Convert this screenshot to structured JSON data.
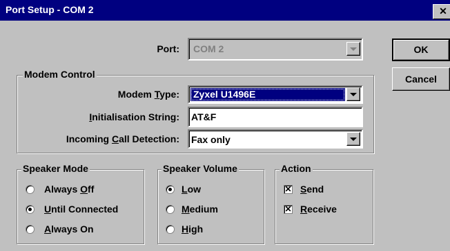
{
  "window": {
    "title": "Port Setup - COM 2",
    "close_glyph": "✕"
  },
  "port": {
    "label": "Port:",
    "value": "COM 2"
  },
  "buttons": {
    "ok": "OK",
    "cancel": "Cancel"
  },
  "modem_control": {
    "title": "Modem Control",
    "type_label_pre": "Modem ",
    "type_label_key": "T",
    "type_label_post": "ype:",
    "type_value": "Zyxel U1496E",
    "init_label_key": "I",
    "init_label_post": "nitialisation String:",
    "init_value": "AT&F",
    "call_label_pre": "Incoming ",
    "call_label_key": "C",
    "call_label_post": "all Detection:",
    "call_value": "Fax only"
  },
  "speaker_mode": {
    "title": "Speaker Mode",
    "options": [
      {
        "pre": "Always ",
        "key": "O",
        "post": "ff",
        "selected": false
      },
      {
        "pre": "",
        "key": "U",
        "post": "ntil Connected",
        "selected": true
      },
      {
        "pre": "",
        "key": "A",
        "post": "lways On",
        "selected": false
      }
    ]
  },
  "speaker_volume": {
    "title": "Speaker Volume",
    "options": [
      {
        "pre": "",
        "key": "L",
        "post": "ow",
        "selected": true
      },
      {
        "pre": "",
        "key": "M",
        "post": "edium",
        "selected": false
      },
      {
        "pre": "",
        "key": "H",
        "post": "igh",
        "selected": false
      }
    ]
  },
  "action": {
    "title": "Action",
    "check_glyph": "✕",
    "options": [
      {
        "key": "S",
        "post": "end",
        "checked": true
      },
      {
        "key": "R",
        "post": "eceive",
        "checked": true
      }
    ]
  }
}
